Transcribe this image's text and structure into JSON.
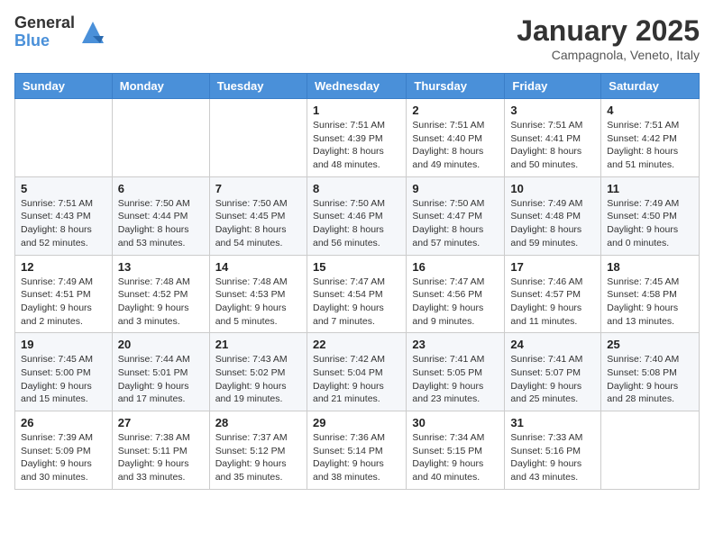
{
  "logo": {
    "general": "General",
    "blue": "Blue"
  },
  "header": {
    "month": "January 2025",
    "location": "Campagnola, Veneto, Italy"
  },
  "weekdays": [
    "Sunday",
    "Monday",
    "Tuesday",
    "Wednesday",
    "Thursday",
    "Friday",
    "Saturday"
  ],
  "weeks": [
    [
      {
        "day": "",
        "info": ""
      },
      {
        "day": "",
        "info": ""
      },
      {
        "day": "",
        "info": ""
      },
      {
        "day": "1",
        "info": "Sunrise: 7:51 AM\nSunset: 4:39 PM\nDaylight: 8 hours and 48 minutes."
      },
      {
        "day": "2",
        "info": "Sunrise: 7:51 AM\nSunset: 4:40 PM\nDaylight: 8 hours and 49 minutes."
      },
      {
        "day": "3",
        "info": "Sunrise: 7:51 AM\nSunset: 4:41 PM\nDaylight: 8 hours and 50 minutes."
      },
      {
        "day": "4",
        "info": "Sunrise: 7:51 AM\nSunset: 4:42 PM\nDaylight: 8 hours and 51 minutes."
      }
    ],
    [
      {
        "day": "5",
        "info": "Sunrise: 7:51 AM\nSunset: 4:43 PM\nDaylight: 8 hours and 52 minutes."
      },
      {
        "day": "6",
        "info": "Sunrise: 7:50 AM\nSunset: 4:44 PM\nDaylight: 8 hours and 53 minutes."
      },
      {
        "day": "7",
        "info": "Sunrise: 7:50 AM\nSunset: 4:45 PM\nDaylight: 8 hours and 54 minutes."
      },
      {
        "day": "8",
        "info": "Sunrise: 7:50 AM\nSunset: 4:46 PM\nDaylight: 8 hours and 56 minutes."
      },
      {
        "day": "9",
        "info": "Sunrise: 7:50 AM\nSunset: 4:47 PM\nDaylight: 8 hours and 57 minutes."
      },
      {
        "day": "10",
        "info": "Sunrise: 7:49 AM\nSunset: 4:48 PM\nDaylight: 8 hours and 59 minutes."
      },
      {
        "day": "11",
        "info": "Sunrise: 7:49 AM\nSunset: 4:50 PM\nDaylight: 9 hours and 0 minutes."
      }
    ],
    [
      {
        "day": "12",
        "info": "Sunrise: 7:49 AM\nSunset: 4:51 PM\nDaylight: 9 hours and 2 minutes."
      },
      {
        "day": "13",
        "info": "Sunrise: 7:48 AM\nSunset: 4:52 PM\nDaylight: 9 hours and 3 minutes."
      },
      {
        "day": "14",
        "info": "Sunrise: 7:48 AM\nSunset: 4:53 PM\nDaylight: 9 hours and 5 minutes."
      },
      {
        "day": "15",
        "info": "Sunrise: 7:47 AM\nSunset: 4:54 PM\nDaylight: 9 hours and 7 minutes."
      },
      {
        "day": "16",
        "info": "Sunrise: 7:47 AM\nSunset: 4:56 PM\nDaylight: 9 hours and 9 minutes."
      },
      {
        "day": "17",
        "info": "Sunrise: 7:46 AM\nSunset: 4:57 PM\nDaylight: 9 hours and 11 minutes."
      },
      {
        "day": "18",
        "info": "Sunrise: 7:45 AM\nSunset: 4:58 PM\nDaylight: 9 hours and 13 minutes."
      }
    ],
    [
      {
        "day": "19",
        "info": "Sunrise: 7:45 AM\nSunset: 5:00 PM\nDaylight: 9 hours and 15 minutes."
      },
      {
        "day": "20",
        "info": "Sunrise: 7:44 AM\nSunset: 5:01 PM\nDaylight: 9 hours and 17 minutes."
      },
      {
        "day": "21",
        "info": "Sunrise: 7:43 AM\nSunset: 5:02 PM\nDaylight: 9 hours and 19 minutes."
      },
      {
        "day": "22",
        "info": "Sunrise: 7:42 AM\nSunset: 5:04 PM\nDaylight: 9 hours and 21 minutes."
      },
      {
        "day": "23",
        "info": "Sunrise: 7:41 AM\nSunset: 5:05 PM\nDaylight: 9 hours and 23 minutes."
      },
      {
        "day": "24",
        "info": "Sunrise: 7:41 AM\nSunset: 5:07 PM\nDaylight: 9 hours and 25 minutes."
      },
      {
        "day": "25",
        "info": "Sunrise: 7:40 AM\nSunset: 5:08 PM\nDaylight: 9 hours and 28 minutes."
      }
    ],
    [
      {
        "day": "26",
        "info": "Sunrise: 7:39 AM\nSunset: 5:09 PM\nDaylight: 9 hours and 30 minutes."
      },
      {
        "day": "27",
        "info": "Sunrise: 7:38 AM\nSunset: 5:11 PM\nDaylight: 9 hours and 33 minutes."
      },
      {
        "day": "28",
        "info": "Sunrise: 7:37 AM\nSunset: 5:12 PM\nDaylight: 9 hours and 35 minutes."
      },
      {
        "day": "29",
        "info": "Sunrise: 7:36 AM\nSunset: 5:14 PM\nDaylight: 9 hours and 38 minutes."
      },
      {
        "day": "30",
        "info": "Sunrise: 7:34 AM\nSunset: 5:15 PM\nDaylight: 9 hours and 40 minutes."
      },
      {
        "day": "31",
        "info": "Sunrise: 7:33 AM\nSunset: 5:16 PM\nDaylight: 9 hours and 43 minutes."
      },
      {
        "day": "",
        "info": ""
      }
    ]
  ]
}
